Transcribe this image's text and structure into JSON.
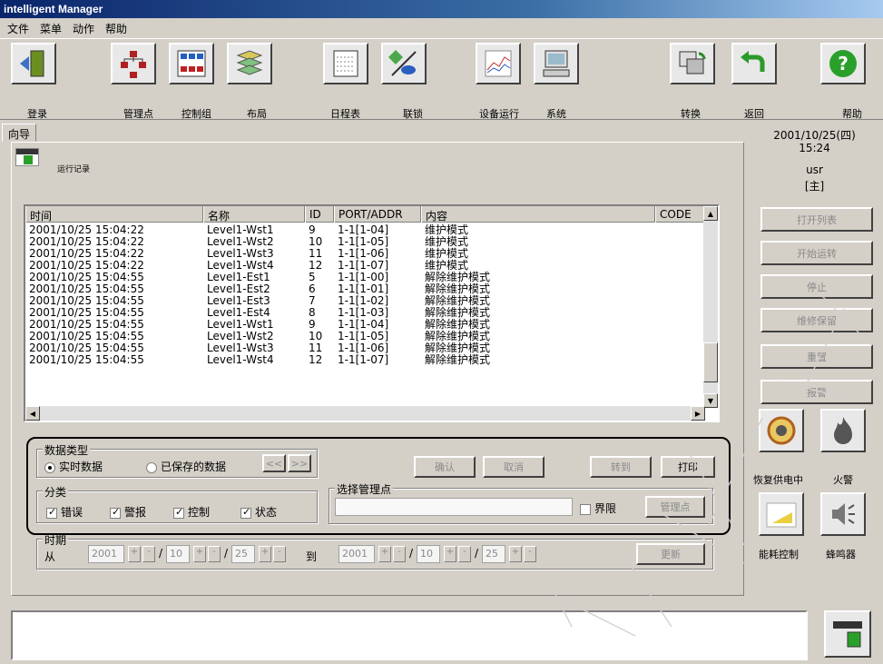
{
  "window": {
    "title": "intelligent Manager"
  },
  "menu": [
    "文件",
    "菜单",
    "动作",
    "帮助"
  ],
  "toolbar": [
    {
      "label": "登录",
      "icon": "login-door-icon"
    },
    {
      "label": "管理点",
      "icon": "hierarchy-icon"
    },
    {
      "label": "控制组",
      "icon": "control-group-icon"
    },
    {
      "label": "布局",
      "icon": "layers-icon"
    },
    {
      "label": "日程表",
      "icon": "calendar-icon"
    },
    {
      "label": "联锁",
      "icon": "interlock-icon"
    },
    {
      "label": "设备运行",
      "icon": "chart-icon"
    },
    {
      "label": "系统",
      "icon": "computer-icon"
    },
    {
      "label": "转换",
      "icon": "windows-switch-icon"
    },
    {
      "label": "返回",
      "icon": "back-arrow-icon"
    },
    {
      "label": "帮助",
      "icon": "help-icon"
    }
  ],
  "tab": {
    "label": "向导"
  },
  "panel": {
    "subtitle": "运行记录"
  },
  "info": {
    "date": "2001/10/25(四)",
    "time": "15:24",
    "user": "usr",
    "role": "[主]"
  },
  "side_buttons": [
    "打开列表",
    "开始运转",
    "停止",
    "维修保留",
    "重置",
    "报警"
  ],
  "side_icons": [
    {
      "label": "恢复供电中",
      "icon": "power-restore-icon"
    },
    {
      "label": "火警",
      "icon": "fire-icon"
    },
    {
      "label": "能耗控制",
      "icon": "energy-icon"
    },
    {
      "label": "蜂鸣器",
      "icon": "speaker-icon"
    }
  ],
  "table": {
    "columns": [
      "时间",
      "名称",
      "ID",
      "PORT/ADDR",
      "内容",
      "CODE"
    ],
    "rows": [
      [
        "2001/10/25  15:04:22",
        "Level1-Wst1",
        "9",
        "1-1[1-04]",
        "维护模式",
        ""
      ],
      [
        "2001/10/25  15:04:22",
        "Level1-Wst2",
        "10",
        "1-1[1-05]",
        "维护模式",
        ""
      ],
      [
        "2001/10/25  15:04:22",
        "Level1-Wst3",
        "11",
        "1-1[1-06]",
        "维护模式",
        ""
      ],
      [
        "2001/10/25  15:04:22",
        "Level1-Wst4",
        "12",
        "1-1[1-07]",
        "维护模式",
        ""
      ],
      [
        "2001/10/25  15:04:55",
        "Level1-Est1",
        "5",
        "1-1[1-00]",
        "解除维护模式",
        ""
      ],
      [
        "2001/10/25  15:04:55",
        "Level1-Est2",
        "6",
        "1-1[1-01]",
        "解除维护模式",
        ""
      ],
      [
        "2001/10/25  15:04:55",
        "Level1-Est3",
        "7",
        "1-1[1-02]",
        "解除维护模式",
        ""
      ],
      [
        "2001/10/25  15:04:55",
        "Level1-Est4",
        "8",
        "1-1[1-03]",
        "解除维护模式",
        ""
      ],
      [
        "2001/10/25  15:04:55",
        "Level1-Wst1",
        "9",
        "1-1[1-04]",
        "解除维护模式",
        ""
      ],
      [
        "2001/10/25  15:04:55",
        "Level1-Wst2",
        "10",
        "1-1[1-05]",
        "解除维护模式",
        ""
      ],
      [
        "2001/10/25  15:04:55",
        "Level1-Wst3",
        "11",
        "1-1[1-06]",
        "解除维护模式",
        ""
      ],
      [
        "2001/10/25  15:04:55",
        "Level1-Wst4",
        "12",
        "1-1[1-07]",
        "解除维护模式",
        ""
      ]
    ]
  },
  "datatype": {
    "title": "数据类型",
    "realtime": "实时数据",
    "saved": "已保存的数据",
    "prev": "<<",
    "next": ">>"
  },
  "category": {
    "title": "分类",
    "error": "错误",
    "alarm": "警报",
    "control": "控制",
    "status": "状态"
  },
  "actions": {
    "confirm": "确认",
    "cancel": "取消",
    "transfer": "转到",
    "print": "打印"
  },
  "mgmt": {
    "title": "选择管理点",
    "boundary": "界限",
    "button": "管理点"
  },
  "period": {
    "title": "时期",
    "from": "从",
    "to": "到",
    "from_year": "2001",
    "from_month": "10",
    "from_day": "25",
    "to_year": "2001",
    "to_month": "10",
    "to_day": "25",
    "update": "更新"
  }
}
